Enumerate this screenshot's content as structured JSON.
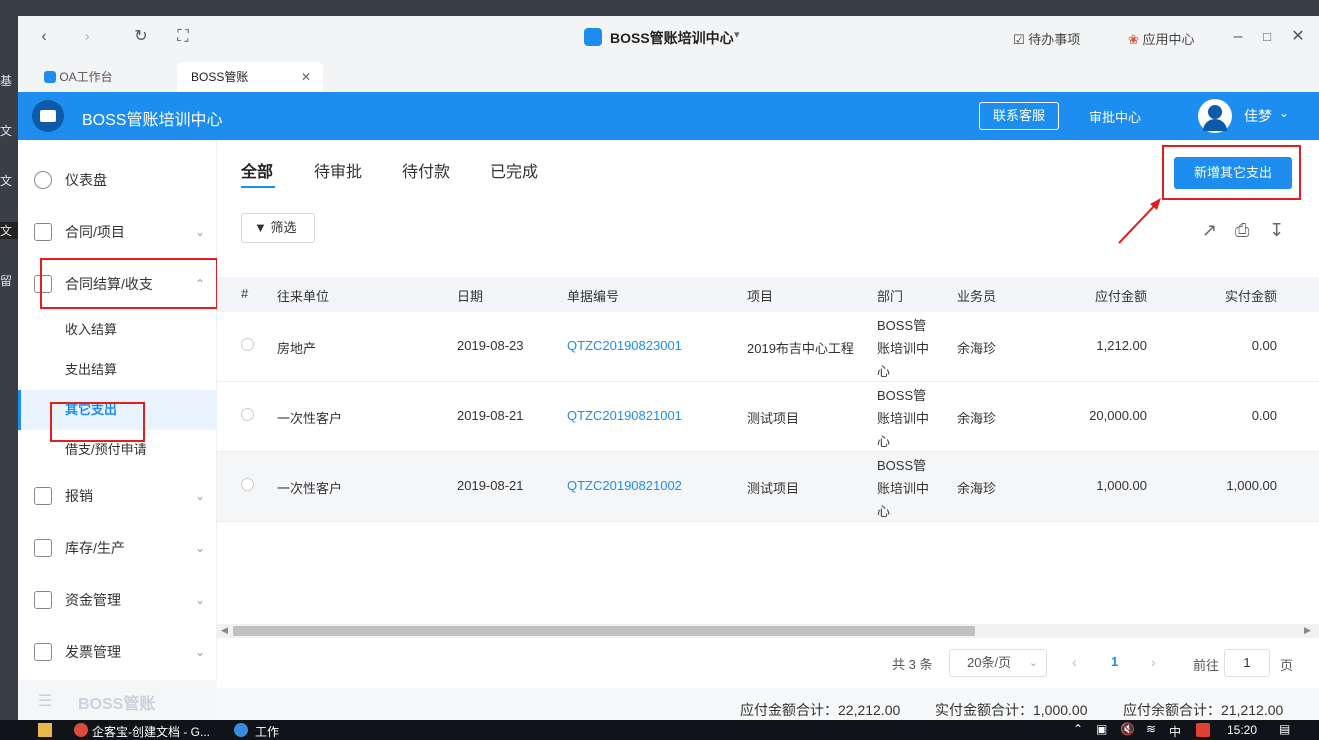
{
  "desktop": {
    "left_labels": [
      "基",
      "文",
      "文",
      "文",
      "留"
    ]
  },
  "window": {
    "title": "BOSS管账培训中心",
    "todo": "待办事项",
    "app_center": "应用中心",
    "tabs": [
      {
        "label": "OA工作台"
      },
      {
        "label": "BOSS管账"
      }
    ]
  },
  "header": {
    "title": "BOSS管账培训中心",
    "contact": "联系客服",
    "approval": "审批中心",
    "user": "佳梦"
  },
  "sidebar": {
    "items": [
      {
        "label": "仪表盘"
      },
      {
        "label": "合同/项目"
      },
      {
        "label": "合同结算/收支"
      },
      {
        "label": "报销"
      },
      {
        "label": "库存/生产"
      },
      {
        "label": "资金管理"
      },
      {
        "label": "发票管理"
      }
    ],
    "subs": [
      {
        "label": "收入结算"
      },
      {
        "label": "支出结算"
      },
      {
        "label": "其它支出"
      },
      {
        "label": "借支/预付申请"
      }
    ],
    "footer_logo": "BOSS管账"
  },
  "main": {
    "tabs": [
      "全部",
      "待审批",
      "待付款",
      "已完成"
    ],
    "add_button": "新增其它支出",
    "filter": "筛选",
    "columns": [
      "#",
      "往来单位",
      "日期",
      "单据编号",
      "项目",
      "部门",
      "业务员",
      "应付金额",
      "实付金额"
    ],
    "rows": [
      {
        "unit": "房地产",
        "date": "2019-08-23",
        "no": "QTZC20190823001",
        "project": "2019布吉中心工程",
        "dept1": "BOSS管",
        "dept2": "账培训中",
        "dept3": "心",
        "staff": "余海珍",
        "payable": "1,212.00",
        "paid": "0.00"
      },
      {
        "unit": "一次性客户",
        "date": "2019-08-21",
        "no": "QTZC20190821001",
        "project": "测试项目",
        "dept1": "BOSS管",
        "dept2": "账培训中",
        "dept3": "心",
        "staff": "余海珍",
        "payable": "20,000.00",
        "paid": "0.00"
      },
      {
        "unit": "一次性客户",
        "date": "2019-08-21",
        "no": "QTZC20190821002",
        "project": "测试项目",
        "dept1": "BOSS管",
        "dept2": "账培训中",
        "dept3": "心",
        "staff": "余海珍",
        "payable": "1,000.00",
        "paid": "1,000.00"
      }
    ],
    "pagination": {
      "total": "共 3 条",
      "page_size": "20条/页",
      "current": "1",
      "goto_label": "前往",
      "goto_value": "1",
      "page_unit": "页"
    },
    "summary": {
      "payable": "应付金额合计：22,212.00",
      "paid": "实付金额合计：1,000.00",
      "remaining": "应付余额合计：21,212.00"
    }
  },
  "taskbar": {
    "items": [
      "企客宝-创建文档 - G...",
      "工作"
    ],
    "lang": "中",
    "time": "15:20"
  }
}
